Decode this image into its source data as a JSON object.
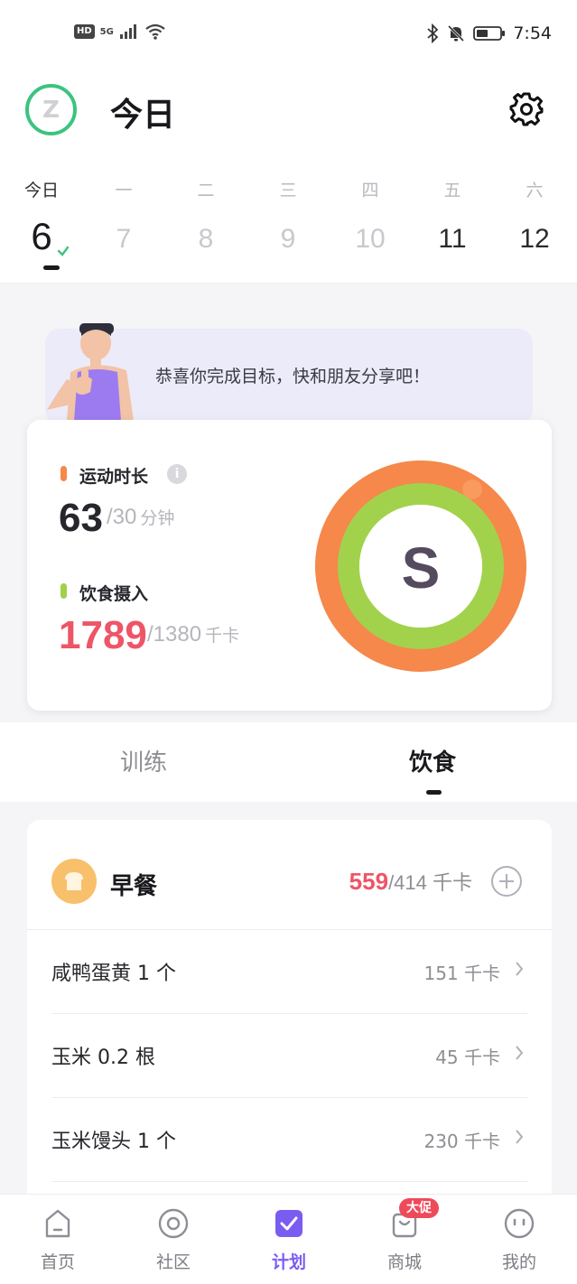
{
  "status_bar": {
    "hd": "HD",
    "signal": "5G",
    "time": "7:54"
  },
  "header": {
    "avatar_initial": "Z",
    "title": "今日"
  },
  "week": {
    "labels": [
      "今日",
      "一",
      "二",
      "三",
      "四",
      "五",
      "六"
    ],
    "dates": [
      "6",
      "7",
      "8",
      "9",
      "10",
      "11",
      "12"
    ]
  },
  "banner": {
    "text": "恭喜你完成目标，快和朋友分享吧！"
  },
  "summary": {
    "exercise": {
      "label": "运动时长",
      "value": "63",
      "goal": "/30",
      "unit": "分钟",
      "color": "#f5884a"
    },
    "diet": {
      "label": "饮食摄入",
      "value": "1789",
      "goal": "/1380",
      "unit": "千卡",
      "color": "#9fd14a"
    },
    "ring_letter": "S",
    "value_color_exceeded": "#ee5567"
  },
  "tabs": {
    "train": "训练",
    "diet": "饮食",
    "active": "diet"
  },
  "meal": {
    "title": "早餐",
    "eaten": "559",
    "target": "/414 千卡",
    "foods": [
      {
        "name": "咸鸭蛋黄 1 个",
        "cal": "151 千卡"
      },
      {
        "name": "玉米 0.2 根",
        "cal": "45 千卡"
      },
      {
        "name": "玉米馒头 1 个",
        "cal": "230 千卡"
      }
    ]
  },
  "nav": {
    "items": [
      {
        "label": "首页",
        "icon": "home-icon"
      },
      {
        "label": "社区",
        "icon": "community-icon"
      },
      {
        "label": "计划",
        "icon": "plan-check-icon"
      },
      {
        "label": "商城",
        "icon": "shop-bag-icon"
      },
      {
        "label": "我的",
        "icon": "profile-face-icon"
      }
    ],
    "active_index": 2,
    "promo_badge": "大促",
    "accent": "#7b5cf0"
  }
}
